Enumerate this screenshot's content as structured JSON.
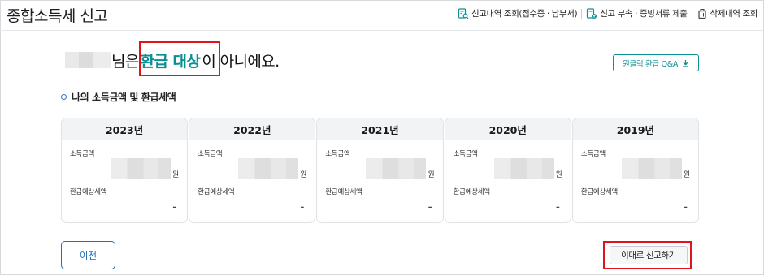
{
  "header": {
    "title": "종합소득세 신고",
    "links": [
      {
        "label": "신고내역 조회(접수증 · 납부서)",
        "icon": "document-search-icon"
      },
      {
        "label": "신고 부속 · 증빙서류 제출",
        "icon": "document-upload-icon"
      },
      {
        "label": "삭제내역 조회",
        "icon": "trash-icon"
      }
    ]
  },
  "headline": {
    "suffix_before": "님은 ",
    "highlight": "환급 대상",
    "suffix_after": "이 아니에요."
  },
  "faq_button": {
    "label": "원클릭 환급 Q&A"
  },
  "section": {
    "title": "나의 소득금액 및 환급세액"
  },
  "cards": [
    {
      "year": "2023년",
      "income_label": "소득금액",
      "unit": "원",
      "refund_label": "환급예상세액",
      "refund_value": "-"
    },
    {
      "year": "2022년",
      "income_label": "소득금액",
      "unit": "원",
      "refund_label": "환급예상세액",
      "refund_value": "-"
    },
    {
      "year": "2021년",
      "income_label": "소득금액",
      "unit": "원",
      "refund_label": "환급예상세액",
      "refund_value": "-"
    },
    {
      "year": "2020년",
      "income_label": "소득금액",
      "unit": "원",
      "refund_label": "환급예상세액",
      "refund_value": "-"
    },
    {
      "year": "2019년",
      "income_label": "소득금액",
      "unit": "원",
      "refund_label": "환급예상세액",
      "refund_value": "-"
    }
  ],
  "buttons": {
    "prev": "이전",
    "submit": "이대로 신고하기"
  },
  "colors": {
    "accent": "#0a8f93",
    "primary_blue": "#1c6fb8",
    "annotation_red": "#e0141b"
  }
}
